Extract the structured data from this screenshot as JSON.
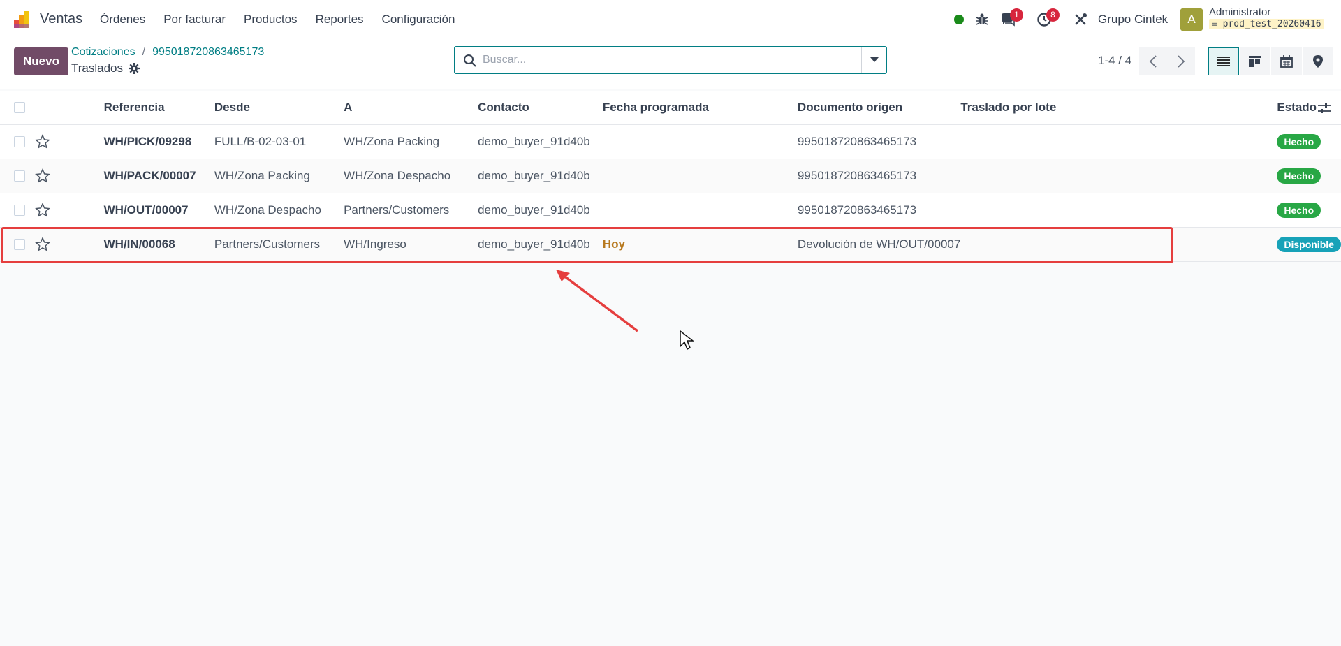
{
  "navbar": {
    "app_name": "Ventas",
    "menu": [
      "Órdenes",
      "Por facturar",
      "Productos",
      "Reportes",
      "Configuración"
    ],
    "messages_count": "1",
    "activities_count": "8",
    "company": "Grupo Cintek",
    "avatar_letter": "A",
    "user_name": "Administrator",
    "database": "prod_test_20260416",
    "status_color": "#1a8a1a"
  },
  "control": {
    "new_button": "Nuevo",
    "breadcrumb": [
      "Cotizaciones",
      "995018720863465173"
    ],
    "breadcrumb_sep": "/",
    "title": "Traslados",
    "search_placeholder": "Buscar...",
    "pager": "1-4 / 4"
  },
  "table": {
    "columns": [
      "Referencia",
      "Desde",
      "A",
      "Contacto",
      "Fecha programada",
      "Documento origen",
      "Traslado por lote",
      "Estado"
    ],
    "rows": [
      {
        "ref": "WH/PICK/09298",
        "from": "FULL/B-02-03-01",
        "to": "WH/Zona Packing",
        "contact": "demo_buyer_91d40b",
        "date": "",
        "origin": "995018720863465173",
        "batch": "",
        "state": "Hecho",
        "state_color": "#28a745"
      },
      {
        "ref": "WH/PACK/00007",
        "from": "WH/Zona Packing",
        "to": "WH/Zona Despacho",
        "contact": "demo_buyer_91d40b",
        "date": "",
        "origin": "995018720863465173",
        "batch": "",
        "state": "Hecho",
        "state_color": "#28a745"
      },
      {
        "ref": "WH/OUT/00007",
        "from": "WH/Zona Despacho",
        "to": "Partners/Customers",
        "contact": "demo_buyer_91d40b",
        "date": "",
        "origin": "995018720863465173",
        "batch": "",
        "state": "Hecho",
        "state_color": "#28a745"
      },
      {
        "ref": "WH/IN/00068",
        "from": "Partners/Customers",
        "to": "WH/Ingreso",
        "contact": "demo_buyer_91d40b",
        "date": "Hoy",
        "origin": "Devolución de WH/OUT/00007",
        "batch": "",
        "state": "Disponible",
        "state_color": "#17a2b8"
      }
    ]
  },
  "colors": {
    "brand": "#714b67",
    "link": "#017e84",
    "highlight": "#e53e3e"
  }
}
